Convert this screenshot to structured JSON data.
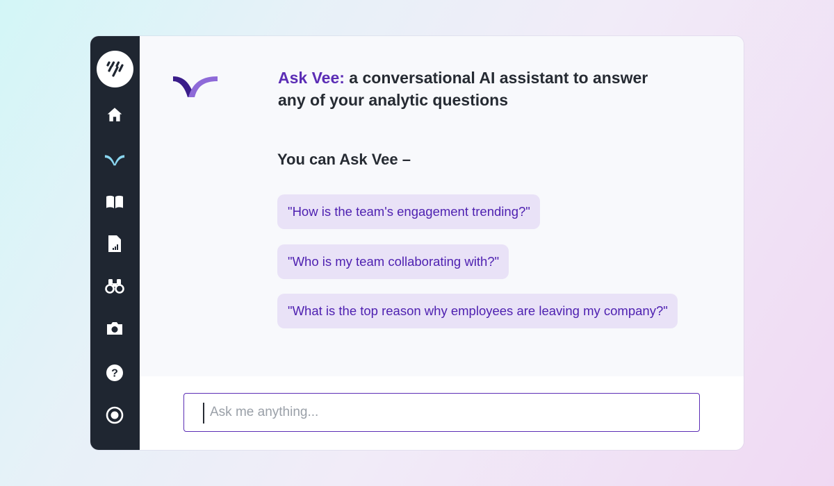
{
  "sidebar": {
    "items": [
      {
        "name": "home-icon"
      },
      {
        "name": "vee-icon",
        "active": true
      },
      {
        "name": "book-icon"
      },
      {
        "name": "report-icon"
      },
      {
        "name": "binoculars-icon"
      },
      {
        "name": "camera-icon"
      },
      {
        "name": "help-icon"
      },
      {
        "name": "user-icon"
      }
    ]
  },
  "header": {
    "brand": "Ask Vee:",
    "title_rest": " a conversational AI assistant to answer any of your analytic questions"
  },
  "prompt_section": {
    "heading": "You can Ask Vee –",
    "suggestions": [
      "\"How is the team's engagement trending?\"",
      "\"Who is my team collaborating with?\"",
      "\"What is the top reason why employees are leaving my company?\""
    ]
  },
  "input": {
    "placeholder": "Ask me anything..."
  },
  "colors": {
    "accent": "#5b2db5",
    "accent_light": "#8e6ad8",
    "chip_bg": "#e9e2f7",
    "sidebar_bg": "#1f2631",
    "active_icon": "#8ad6f0"
  }
}
